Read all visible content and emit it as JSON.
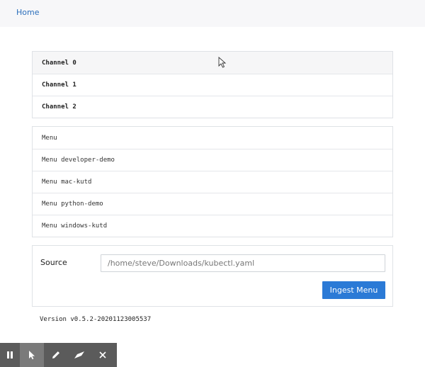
{
  "nav": {
    "home_label": "Home"
  },
  "channels": [
    {
      "label": "Channel 0"
    },
    {
      "label": "Channel 1"
    },
    {
      "label": "Channel 2"
    }
  ],
  "menus": [
    {
      "label": "Menu"
    },
    {
      "label": "Menu developer-demo"
    },
    {
      "label": "Menu mac-kutd"
    },
    {
      "label": "Menu python-demo"
    },
    {
      "label": "Menu windows-kutd"
    }
  ],
  "ingest": {
    "source_label": "Source",
    "source_value": "/home/steve/Downloads/kubectl.yaml",
    "button_label": "Ingest Menu"
  },
  "version": "Version v0.5.2-20201123005537",
  "toolbar": {
    "tools": [
      "pause-icon",
      "pointer-icon",
      "pen-icon",
      "eraser-icon",
      "close-icon"
    ]
  },
  "colors": {
    "accent": "#2b7ad6",
    "link": "#2a6ebb",
    "toolbar_bg": "#5b5b5b"
  }
}
